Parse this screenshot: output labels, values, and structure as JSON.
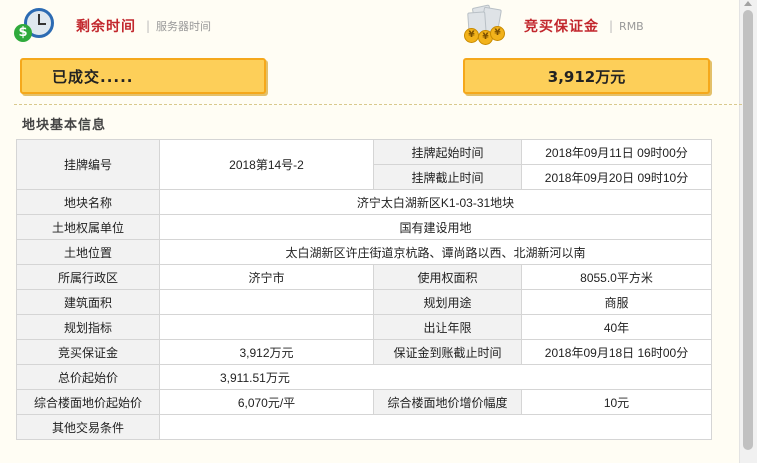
{
  "header": {
    "remaining_time_title": "剩余时间",
    "remaining_time_sub": "服务器时间",
    "deposit_title": "竞买保证金",
    "deposit_sub": "RMB",
    "separator": "|"
  },
  "status": {
    "state_text": "已成交.....",
    "deposit_amount": "3,912万元"
  },
  "section": {
    "title": "地块基本信息"
  },
  "table": {
    "listing_no_label": "挂牌编号",
    "listing_no": "2018第14号-2",
    "start_time_label": "挂牌起始时间",
    "start_time": "2018年09月11日 09时00分",
    "end_time_label": "挂牌截止时间",
    "end_time": "2018年09月20日 09时10分",
    "parcel_name_label": "地块名称",
    "parcel_name": "济宁太白湖新区K1-03-31地块",
    "owner_label": "土地权属单位",
    "owner": "国有建设用地",
    "location_label": "土地位置",
    "location": "太白湖新区许庄街道京杭路、谭尚路以西、北湖新河以南",
    "district_label": "所属行政区",
    "district": "济宁市",
    "use_area_label": "使用权面积",
    "use_area": "8055.0平方米",
    "building_area_label": "建筑面积",
    "building_area": "",
    "planned_use_label": "规划用途",
    "planned_use": "商服",
    "planning_index_label": "规划指标",
    "planning_index": "",
    "term_label": "出让年限",
    "term": "40年",
    "deposit_label": "竞买保证金",
    "deposit": "3,912万元",
    "deposit_deadline_label": "保证金到账截止时间",
    "deposit_deadline": "2018年09月18日 16时00分",
    "start_price_label": "总价起始价",
    "start_price": "3,911.51万元",
    "floor_price_label": "综合楼面地价起始价",
    "floor_price": "6,070元/平",
    "increment_label": "综合楼面地价增价幅度",
    "increment": "10元",
    "other_terms_label": "其他交易条件",
    "other_terms": ""
  },
  "icons": {
    "clock": "clock-money-icon",
    "money": "money-coins-icon",
    "clock_coin_symbol": "$",
    "money_coin_symbol": "¥"
  },
  "colors": {
    "title_red": "#c2272d",
    "status_fill": "#fdcf59",
    "status_border": "#f5a81b"
  }
}
